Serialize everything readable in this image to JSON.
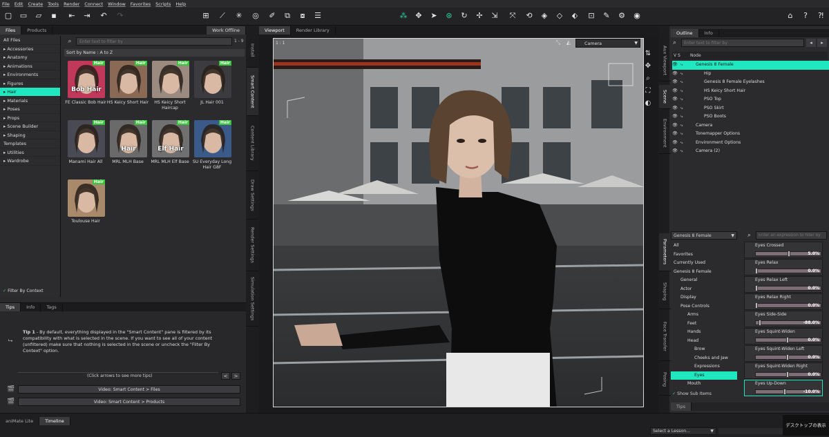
{
  "menu": [
    "File",
    "Edit",
    "Create",
    "Tools",
    "Render",
    "Connect",
    "Window",
    "Favorites",
    "Scripts",
    "Help"
  ],
  "left": {
    "tabs": [
      "Files",
      "Products"
    ],
    "work_offline": "Work Offline",
    "search_placeholder": "Enter text to filter by",
    "page_range": "1 - 9",
    "sort_label": "Sort by Name : A to Z",
    "categories": [
      "All Files",
      "Accessories",
      "Anatomy",
      "Animations",
      "Environments",
      "Figures",
      "Hair",
      "Materials",
      "Poses",
      "Props",
      "Scene Builder",
      "Shaping",
      "Templates",
      "Utilities",
      "Wardrobe"
    ],
    "selected_category": "Hair",
    "filter_by_context": "Filter By Context",
    "products": [
      {
        "name": "FE Classic Bob Hair",
        "badge": "Hair",
        "overlay": "Bob Hair",
        "color": "#c0395a"
      },
      {
        "name": "HS Keicy Short Hair",
        "badge": "Hair",
        "overlay": "",
        "color": "#8b6a55"
      },
      {
        "name": "HS Keicy Short Haircap",
        "badge": "Hair",
        "overlay": "",
        "color": "#9a8a80"
      },
      {
        "name": "JL Hair 001",
        "badge": "Hair",
        "overlay": "",
        "color": "#3c3c40"
      },
      {
        "name": "Manami Hair All",
        "badge": "Hair",
        "overlay": "",
        "color": "#4a4a55"
      },
      {
        "name": "MRL MLH Base",
        "badge": "Hair",
        "overlay": "Hair",
        "color": "#6a6a6a"
      },
      {
        "name": "MRL MLH Elf Base",
        "badge": "Hair",
        "overlay": "Elf Hair",
        "color": "#707070"
      },
      {
        "name": "SU Everyday Long Hair G8F",
        "badge": "Hair",
        "overlay": "",
        "color": "#3a5a8a"
      },
      {
        "name": "Toulouse Hair",
        "badge": "Hair",
        "overlay": "",
        "color": "#a88a6a"
      }
    ],
    "tips_tabs": [
      "Tips",
      "Info",
      "Tags"
    ],
    "tip_title": "Tip 1",
    "tip_text": "- By default, everything displayed in the \"Smart Content\" pane is filtered by its compatibility with what is selected in the scene. If you want to see all of your content (unfiltered) make sure that nothing is selected in the scene or uncheck the \"Filter By Context\" option.",
    "tip_nav": "(Click arrows to see more tips)",
    "videos": [
      "Video: Smart Content > Files",
      "Video: Smart Content > Products"
    ]
  },
  "side_tabs": [
    "Install",
    "Smart Content",
    "Content Library",
    "Draw Settings",
    "Render Settings",
    "Simulation Settings"
  ],
  "viewport": {
    "tabs": [
      "Viewport",
      "Render Library"
    ],
    "layout_label": "1 : 1",
    "camera": "Camera"
  },
  "right": {
    "tabs": [
      "Outline",
      "Info"
    ],
    "side_tabs_top": [
      "Aux Viewport",
      "Scene",
      "Environment"
    ],
    "side_tabs_bottom": [
      "Parameters",
      "Shaping",
      "Face Transfer",
      "Posing"
    ],
    "search_placeholder": "Enter text to filter by",
    "node_header": "Node",
    "vs_header": "V  S",
    "nodes": [
      "Genesis 8 Female",
      "Hip",
      "Genesis 8 Female Eyelashes",
      "HS Keicy Short Hair",
      "PSO Top",
      "PSO Skirt",
      "PSO Boots",
      "Camera",
      "Tonemapper Options",
      "Environment Options",
      "Camera (2)"
    ],
    "figure_select": "Genesis 8 Female",
    "expr_placeholder": "Enter an expression to filter by",
    "param_groups": [
      "All",
      "Favorites",
      "Currently Used",
      "Genesis 8 Female",
      "General",
      "Actor",
      "Display",
      "Pose Controls",
      "Arms",
      "Feet",
      "Hands",
      "Head",
      "Brow",
      "Cheeks and Jaw",
      "Expressions",
      "Eyes",
      "Mouth"
    ],
    "show_sub_items": "Show Sub Items",
    "params": [
      {
        "name": "Eyes Crossed",
        "value": "5.0%",
        "level": 0.52
      },
      {
        "name": "Eyes Relax",
        "value": "0.0%",
        "level": 0.0
      },
      {
        "name": "Eyes Relax Left",
        "value": "0.0%",
        "level": 0.0
      },
      {
        "name": "Eyes Relax Right",
        "value": "0.0%",
        "level": 0.0
      },
      {
        "name": "Eyes Side-Side",
        "value": "-88.0%",
        "level": 0.06
      },
      {
        "name": "Eyes Squint-Widen",
        "value": "0.0%",
        "level": 0.5
      },
      {
        "name": "Eyes Squint-Widen Left",
        "value": "0.0%",
        "level": 0.5
      },
      {
        "name": "Eyes Squint-Widen Right",
        "value": "0.0%",
        "level": 0.5
      },
      {
        "name": "Eyes Up-Down",
        "value": "-10.0%",
        "level": 0.45
      }
    ],
    "tips_tab": "Tips"
  },
  "bottom": {
    "tabs": [
      "aniMate Lite",
      "Timeline"
    ],
    "lesson_select": "Select a Lesson...",
    "desktop_label": "デスクトップの表示"
  }
}
